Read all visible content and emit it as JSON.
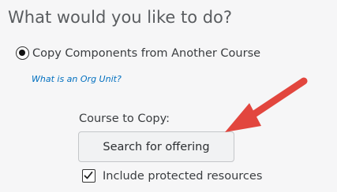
{
  "page": {
    "heading": "What would you like to do?"
  },
  "copy_option": {
    "selected": true,
    "label": "Copy Components from Another Course"
  },
  "help_link": {
    "label": "What is an Org Unit?"
  },
  "course_to_copy": {
    "label": "Course to Copy:",
    "button_label": "Search for offering"
  },
  "protected_resources": {
    "checked": true,
    "label": "Include protected resources"
  },
  "annotation": {
    "type": "arrow",
    "color": "#e2463e",
    "icon": "red-arrow-icon"
  },
  "colors": {
    "link": "#006fbf",
    "text": "#3a3d40",
    "background": "#f6f6f7",
    "button_bg": "#f1f2f3"
  }
}
